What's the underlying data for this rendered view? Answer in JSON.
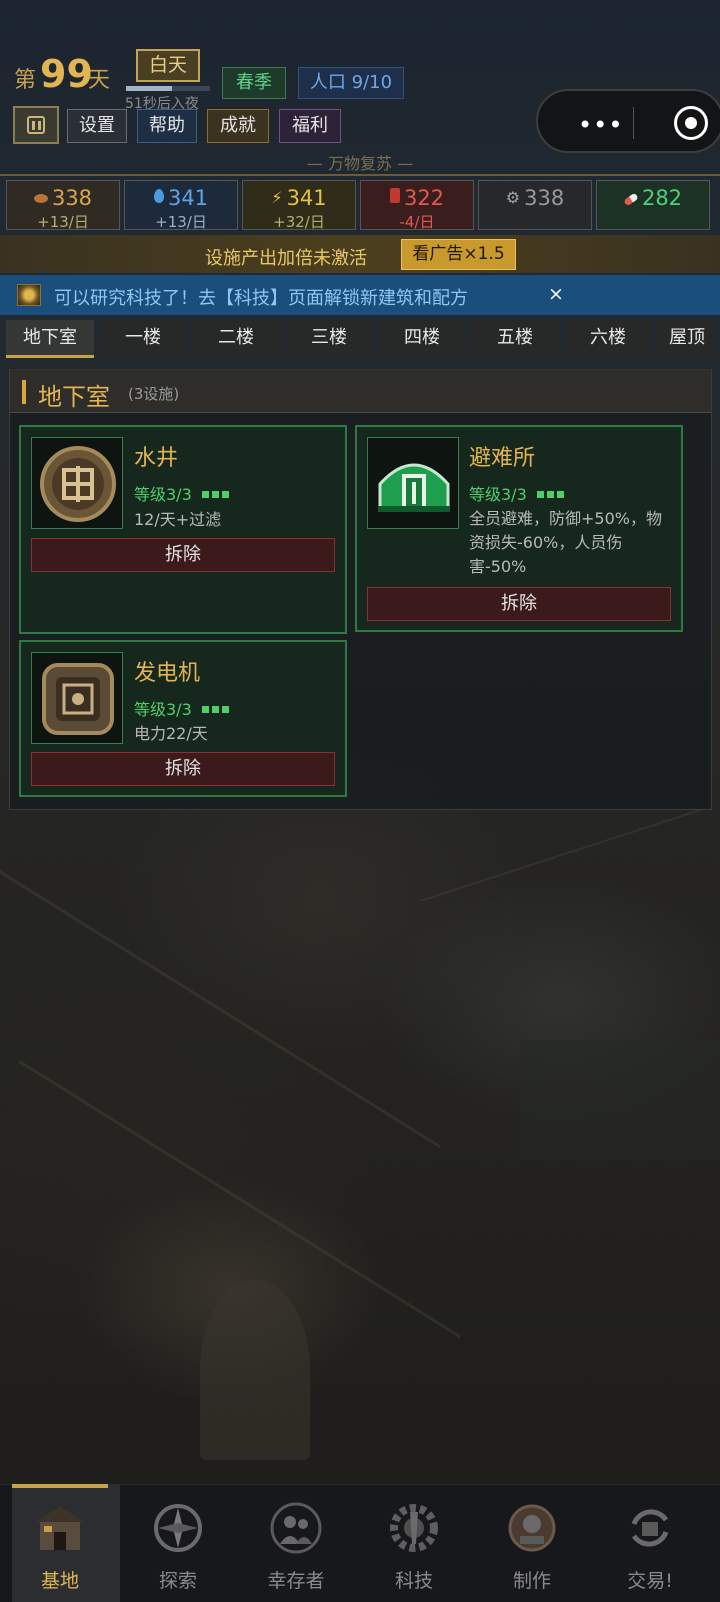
{
  "header": {
    "day_prefix": "第",
    "day_number": "99",
    "day_suffix": "天",
    "daytime": "白天",
    "daytime_progress": 0.55,
    "countdown": "51秒后入夜",
    "season": "春季",
    "population": "人口 9/10",
    "menu": {
      "settings": "设置",
      "help": "帮助",
      "achievements": "成就",
      "welfare": "福利"
    },
    "slogan": "— 万物复苏 —"
  },
  "resources": [
    {
      "icon": "food-icon",
      "value": "338",
      "rate": "+13/日",
      "color": "#d9a64a",
      "rate_color": "#b0b070",
      "bg": "#2f2a22"
    },
    {
      "icon": "water-icon",
      "value": "341",
      "rate": "+13/日",
      "color": "#5fa3e6",
      "rate_color": "#9ab0c8",
      "bg": "#1c2a3c"
    },
    {
      "icon": "energy-icon",
      "value": "341",
      "rate": "+32/日",
      "color": "#e8c040",
      "rate_color": "#b0b070",
      "bg": "#2f2c1a"
    },
    {
      "icon": "fuel-icon",
      "value": "322",
      "rate": "-4/日",
      "color": "#e05a4e",
      "rate_color": "#e05a4e",
      "bg": "#3a1e1e"
    },
    {
      "icon": "gear-icon",
      "value": "338",
      "rate": "",
      "color": "#9a9a9a",
      "rate_color": "#9a9a9a",
      "bg": "#26282b"
    },
    {
      "icon": "medicine-icon",
      "value": "282",
      "rate": "",
      "color": "#4fd17a",
      "rate_color": "#4fd17a",
      "bg": "#1b3224"
    }
  ],
  "ad_banner": {
    "text": "设施产出加倍未激活",
    "button": "看广告×1.5"
  },
  "research_banner": {
    "text": "可以研究科技了！去【科技】页面解锁新建筑和配方",
    "close": "×"
  },
  "floors": [
    "地下室",
    "一楼",
    "二楼",
    "三楼",
    "四楼",
    "五楼",
    "六楼",
    "屋顶"
  ],
  "active_floor": "地下室",
  "panel": {
    "title": "地下室",
    "count": "(3设施)"
  },
  "facilities": [
    {
      "name": "水井",
      "level": "等级3/3",
      "desc": "12/天+过滤",
      "button": "拆除",
      "icon": "well-icon"
    },
    {
      "name": "避难所",
      "level": "等级3/3",
      "desc": "全员避难，防御+50%，物资损失-60%，人员伤害-50%",
      "button": "拆除",
      "icon": "shelter-icon"
    },
    {
      "name": "发电机",
      "level": "等级3/3",
      "desc": "电力22/天",
      "button": "拆除",
      "icon": "generator-icon"
    }
  ],
  "nav": [
    {
      "label": "基地",
      "icon": "base-icon"
    },
    {
      "label": "探索",
      "icon": "compass-icon"
    },
    {
      "label": "幸存者",
      "icon": "survivors-icon"
    },
    {
      "label": "科技",
      "icon": "tech-icon"
    },
    {
      "label": "制作",
      "icon": "craft-icon"
    },
    {
      "label": "交易!",
      "icon": "trade-icon"
    }
  ],
  "active_nav": "基地"
}
